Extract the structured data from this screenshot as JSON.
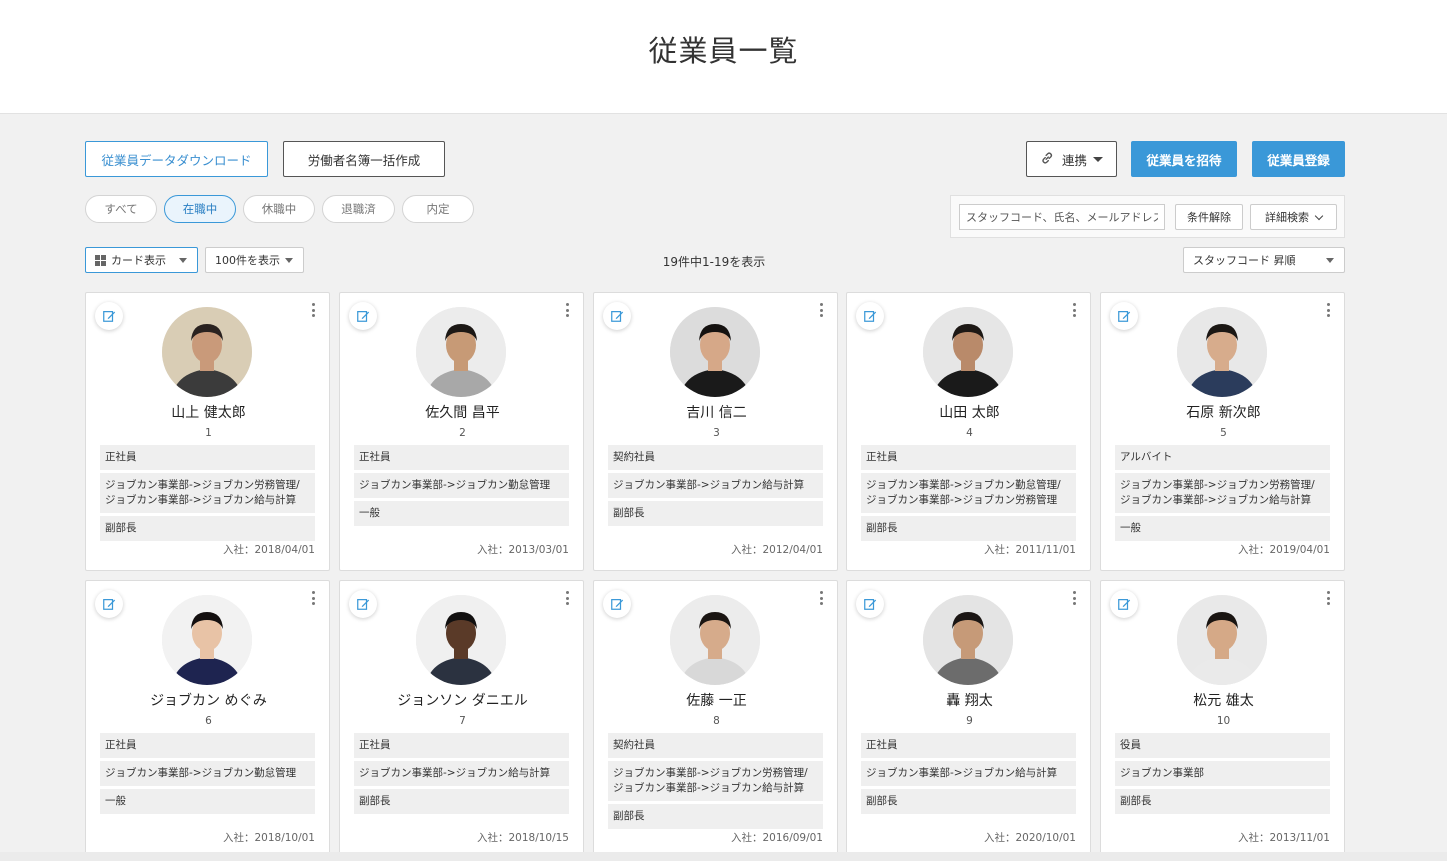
{
  "page": {
    "title": "従業員一覧"
  },
  "toolbar": {
    "download_label": "従業員データダウンロード",
    "register_book_label": "労働者名簿一括作成",
    "integration_label": "連携",
    "invite_label": "従業員を招待",
    "register_label": "従業員登録"
  },
  "filters": {
    "tabs": [
      "すべて",
      "在職中",
      "休職中",
      "退職済",
      "内定"
    ],
    "active_tab": "在職中"
  },
  "search": {
    "placeholder": "スタッフコード、氏名、メールアドレス",
    "clear_label": "条件解除",
    "advanced_label": "詳細検索"
  },
  "list_controls": {
    "view_mode": "カード表示",
    "per_page": "100件を表示",
    "count_text": "19件中1-19を表示",
    "sort": "スタッフコード 昇順"
  },
  "employees": [
    {
      "name": "山上 健太郎",
      "code": "1",
      "tags": [
        "正社員",
        "ジョブカン事業部->ジョブカン労務管理/ジョブカン事業部->ジョブカン給与計算",
        "副部長"
      ],
      "joined": "入社：2018/04/01"
    },
    {
      "name": "佐久間 昌平",
      "code": "2",
      "tags": [
        "正社員",
        "ジョブカン事業部->ジョブカン勤怠管理",
        "一般"
      ],
      "joined": "入社：2013/03/01"
    },
    {
      "name": "吉川 信二",
      "code": "3",
      "tags": [
        "契約社員",
        "ジョブカン事業部->ジョブカン給与計算",
        "副部長"
      ],
      "joined": "入社：2012/04/01"
    },
    {
      "name": "山田 太郎",
      "code": "4",
      "tags": [
        "正社員",
        "ジョブカン事業部->ジョブカン勤怠管理/ジョブカン事業部->ジョブカン労務管理",
        "副部長"
      ],
      "joined": "入社：2011/11/01"
    },
    {
      "name": "石原 新次郎",
      "code": "5",
      "tags": [
        "アルバイト",
        "ジョブカン事業部->ジョブカン労務管理/ジョブカン事業部->ジョブカン給与計算",
        "一般"
      ],
      "joined": "入社：2019/04/01"
    },
    {
      "name": "ジョブカン めぐみ",
      "code": "6",
      "tags": [
        "正社員",
        "ジョブカン事業部->ジョブカン勤怠管理",
        "一般"
      ],
      "joined": "入社：2018/10/01"
    },
    {
      "name": "ジョンソン ダニエル",
      "code": "7",
      "tags": [
        "正社員",
        "ジョブカン事業部->ジョブカン給与計算",
        "副部長"
      ],
      "joined": "入社：2018/10/15"
    },
    {
      "name": "佐藤 一正",
      "code": "8",
      "tags": [
        "契約社員",
        "ジョブカン事業部->ジョブカン労務管理/ジョブカン事業部->ジョブカン給与計算",
        "副部長"
      ],
      "joined": "入社：2016/09/01"
    },
    {
      "name": "轟 翔太",
      "code": "9",
      "tags": [
        "正社員",
        "ジョブカン事業部->ジョブカン給与計算",
        "副部長"
      ],
      "joined": "入社：2020/10/01"
    },
    {
      "name": "松元 雄太",
      "code": "10",
      "tags": [
        "役員",
        "ジョブカン事業部",
        "副部長"
      ],
      "joined": "入社：2013/11/01"
    }
  ],
  "colors": {
    "accent": "#3a98d8",
    "background": "#f1f1f1",
    "tag_bg": "#efefef"
  },
  "icons": {
    "edit": "edit-icon",
    "more": "more-vertical-icon",
    "link": "link-icon",
    "grid": "grid-icon"
  }
}
